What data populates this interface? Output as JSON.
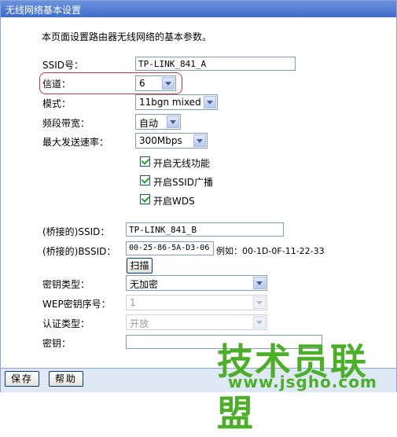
{
  "title": "无线网络基本设置",
  "description": "本页面设置路由器无线网络的基本参数。",
  "ssid": {
    "label": "SSID号：",
    "value": "TP-LINK_841_A"
  },
  "channel": {
    "label": "信道：",
    "value": "6"
  },
  "mode": {
    "label": "模式：",
    "value": "11bgn mixed"
  },
  "bandwidth": {
    "label": "频段带宽：",
    "value": "自动"
  },
  "max_rate": {
    "label": "最大发送速率：",
    "value": "300Mbps"
  },
  "checkboxes": [
    {
      "label": "开启无线功能",
      "checked": true
    },
    {
      "label": "开启SSID广播",
      "checked": true
    },
    {
      "label": "开启WDS",
      "checked": true
    }
  ],
  "bridge": {
    "ssid_label": "(桥接的)SSID：",
    "ssid_value": "TP-LINK_841_B",
    "bssid_label": "(桥接的)BSSID：",
    "bssid_value": "00-25-86-5A-D3-06",
    "example": "例如：00-1D-0F-11-22-33",
    "scan_button": "扫描"
  },
  "key_type": {
    "label": "密钥类型：",
    "value": "无加密"
  },
  "wep_index": {
    "label": "WEP密钥序号：",
    "value": "1"
  },
  "auth_type": {
    "label": "认证类型：",
    "value": "开放"
  },
  "key": {
    "label": "密钥：",
    "value": ""
  },
  "buttons": {
    "save": "保存",
    "help": "帮助"
  },
  "watermark": {
    "main": "技术员联盟",
    "url": "www.jsgho.com"
  }
}
